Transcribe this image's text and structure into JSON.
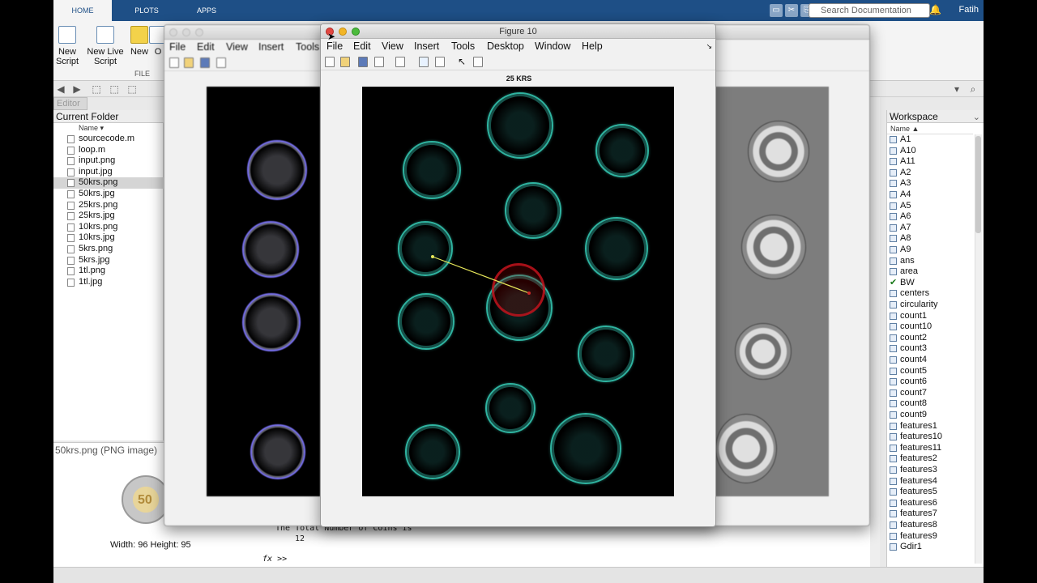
{
  "toolstrip": {
    "tabs": [
      "HOME",
      "PLOTS",
      "APPS"
    ],
    "search_placeholder": "Search Documentation",
    "user": "Fatih"
  },
  "ribbon": {
    "buttons": [
      {
        "label": "New Script",
        "icon": "new-script-icon"
      },
      {
        "label": "New Live Script",
        "icon": "new-live-script-icon"
      },
      {
        "label": "New",
        "icon": "new-plus-icon"
      },
      {
        "label": "O",
        "icon": "open-icon"
      }
    ],
    "group_label": "FILE"
  },
  "editor_tab": "Editor",
  "current_folder": {
    "title": "Current Folder",
    "column": "Name",
    "files": [
      "sourcecode.m",
      "loop.m",
      "input.png",
      "input.jpg",
      "50krs.png",
      "50krs.jpg",
      "25krs.png",
      "25krs.jpg",
      "10krs.png",
      "10krs.jpg",
      "5krs.png",
      "5krs.jpg",
      "1tl.png",
      "1tl.jpg"
    ],
    "selected": "50krs.png"
  },
  "details": {
    "title": "50krs.png  (PNG image)",
    "size_text": "Width: 96 Height: 95",
    "coin_label": "50"
  },
  "command_window": {
    "line1": "The Total Number of Coins is",
    "line2": "12",
    "prompt": ">>",
    "fx": "fx"
  },
  "workspace": {
    "title": "Workspace",
    "column": "Name",
    "variables": [
      "A1",
      "A10",
      "A11",
      "A2",
      "A3",
      "A4",
      "A5",
      "A6",
      "A7",
      "A8",
      "A9",
      "ans",
      "area",
      "BW",
      "centers",
      "circularity",
      "count1",
      "count10",
      "count2",
      "count3",
      "count4",
      "count5",
      "count6",
      "count7",
      "count8",
      "count9",
      "features1",
      "features10",
      "features11",
      "features2",
      "features3",
      "features4",
      "features5",
      "features6",
      "features7",
      "features8",
      "features9",
      "Gdir1"
    ],
    "checked": "BW"
  },
  "figure_back": {
    "menu": [
      "File",
      "Edit",
      "View",
      "Insert",
      "Tools"
    ]
  },
  "figure_front": {
    "title": "Figure 10",
    "menu": [
      "File",
      "Edit",
      "View",
      "Insert",
      "Tools",
      "Desktop",
      "Window",
      "Help"
    ],
    "axes_title": "25 KRS"
  },
  "colors": {
    "matlab_blue": "#1e4f86",
    "coin_teal": "#2fb3a0",
    "coin_blue": "#7a72f5",
    "match_red": "#c8141e",
    "line_yellow": "#e8e85a"
  }
}
